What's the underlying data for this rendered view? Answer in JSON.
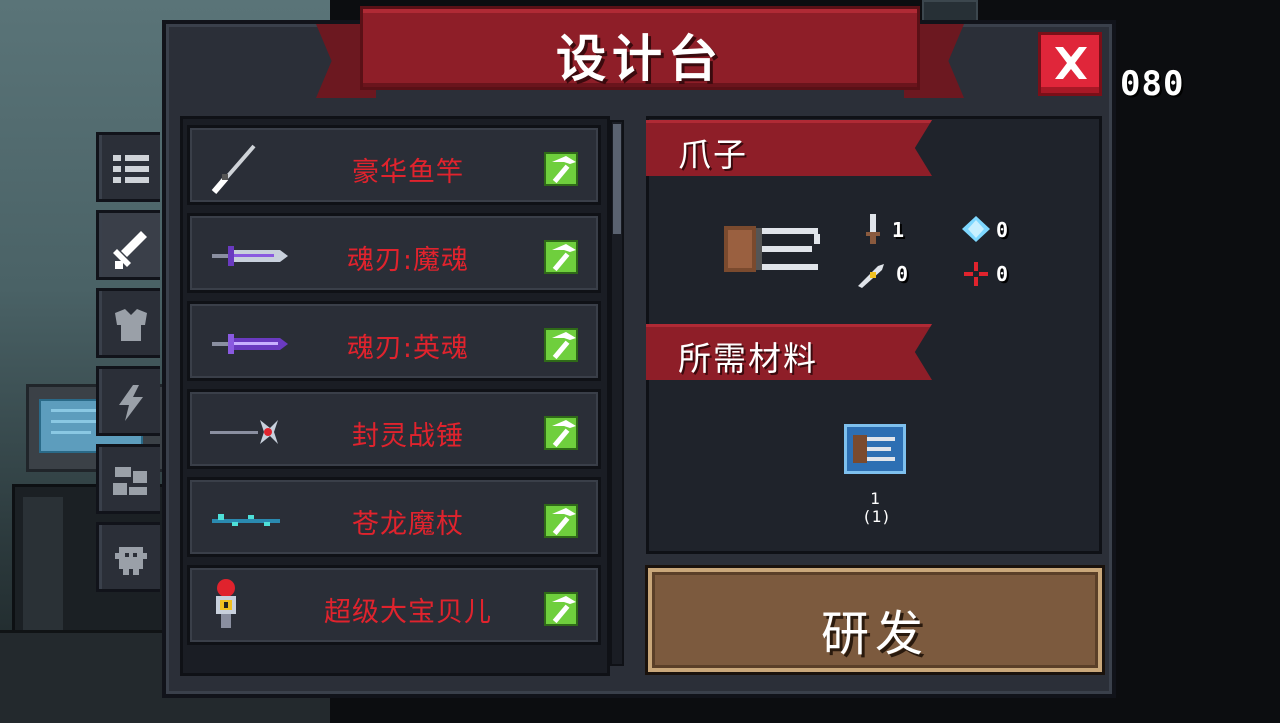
{
  "title": "设计台",
  "close_label": "close",
  "coins": "080",
  "tabs": [
    {
      "icon": "list-icon"
    },
    {
      "icon": "weapon-icon"
    },
    {
      "icon": "armor-icon"
    },
    {
      "icon": "lightning-icon"
    },
    {
      "icon": "material-icon"
    },
    {
      "icon": "pet-icon"
    }
  ],
  "list": [
    {
      "name": "豪华鱼竿",
      "icon": "fishing-rod-icon"
    },
    {
      "name": "魂刃:魔魂",
      "icon": "dark-blade-icon"
    },
    {
      "name": "魂刃:英魂",
      "icon": "purple-blade-icon"
    },
    {
      "name": "封灵战锤",
      "icon": "warhammer-icon"
    },
    {
      "name": "苍龙魔杖",
      "icon": "dragon-staff-icon"
    },
    {
      "name": "超级大宝贝儿",
      "icon": "bomb-robot-icon"
    }
  ],
  "detail": {
    "item_name": "爪子",
    "stats": {
      "damage": "1",
      "energy": "0",
      "crit": "0",
      "accuracy": "0"
    },
    "materials_heading": "所需材料",
    "materials": [
      {
        "icon": "claw-blueprint-icon",
        "count": "1\n(1)"
      }
    ]
  },
  "research_label": "研发",
  "colors": {
    "accent_red": "#8e1e28",
    "item_red": "#e0232d",
    "craft_green": "#6fcf3d",
    "button_brown": "#7c5a3e"
  }
}
